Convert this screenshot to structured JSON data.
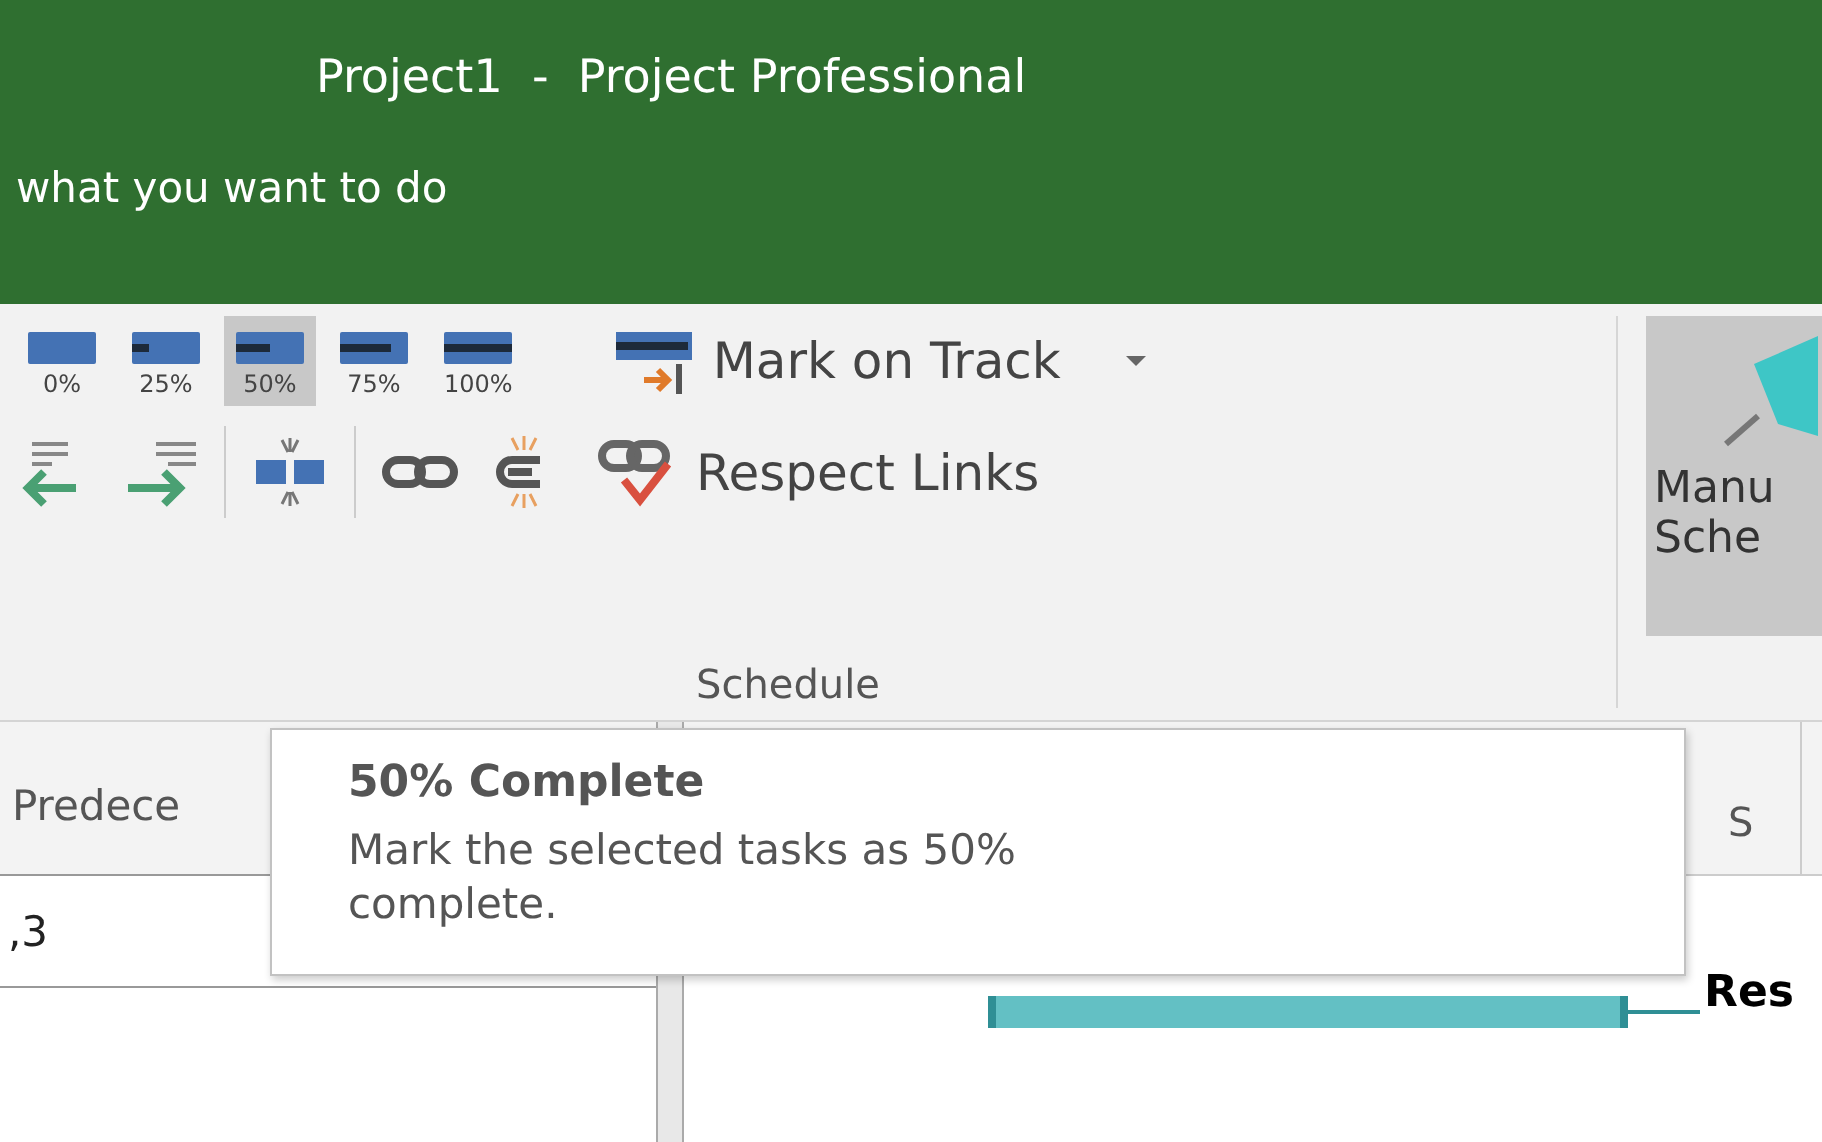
{
  "window": {
    "title": "Project1  -  Project Professional"
  },
  "tell_me": {
    "placeholder": "what you want to do"
  },
  "ribbon": {
    "percent_buttons": [
      {
        "label": "0%",
        "selected": false
      },
      {
        "label": "25%",
        "selected": false
      },
      {
        "label": "50%",
        "selected": true
      },
      {
        "label": "75%",
        "selected": false
      },
      {
        "label": "100%",
        "selected": false
      }
    ],
    "mark_on_track": "Mark on Track",
    "respect_links": "Respect Links",
    "group_label": "Schedule",
    "manual_schedule": [
      "Manu",
      "Sche"
    ]
  },
  "table": {
    "columns": [
      "Predece"
    ],
    "rows": [
      [
        ",3"
      ]
    ]
  },
  "gantt": {
    "header": "S",
    "task_label": "Res"
  },
  "tooltip": {
    "title": "50% Complete",
    "text": "Mark the selected tasks as 50% complete."
  }
}
